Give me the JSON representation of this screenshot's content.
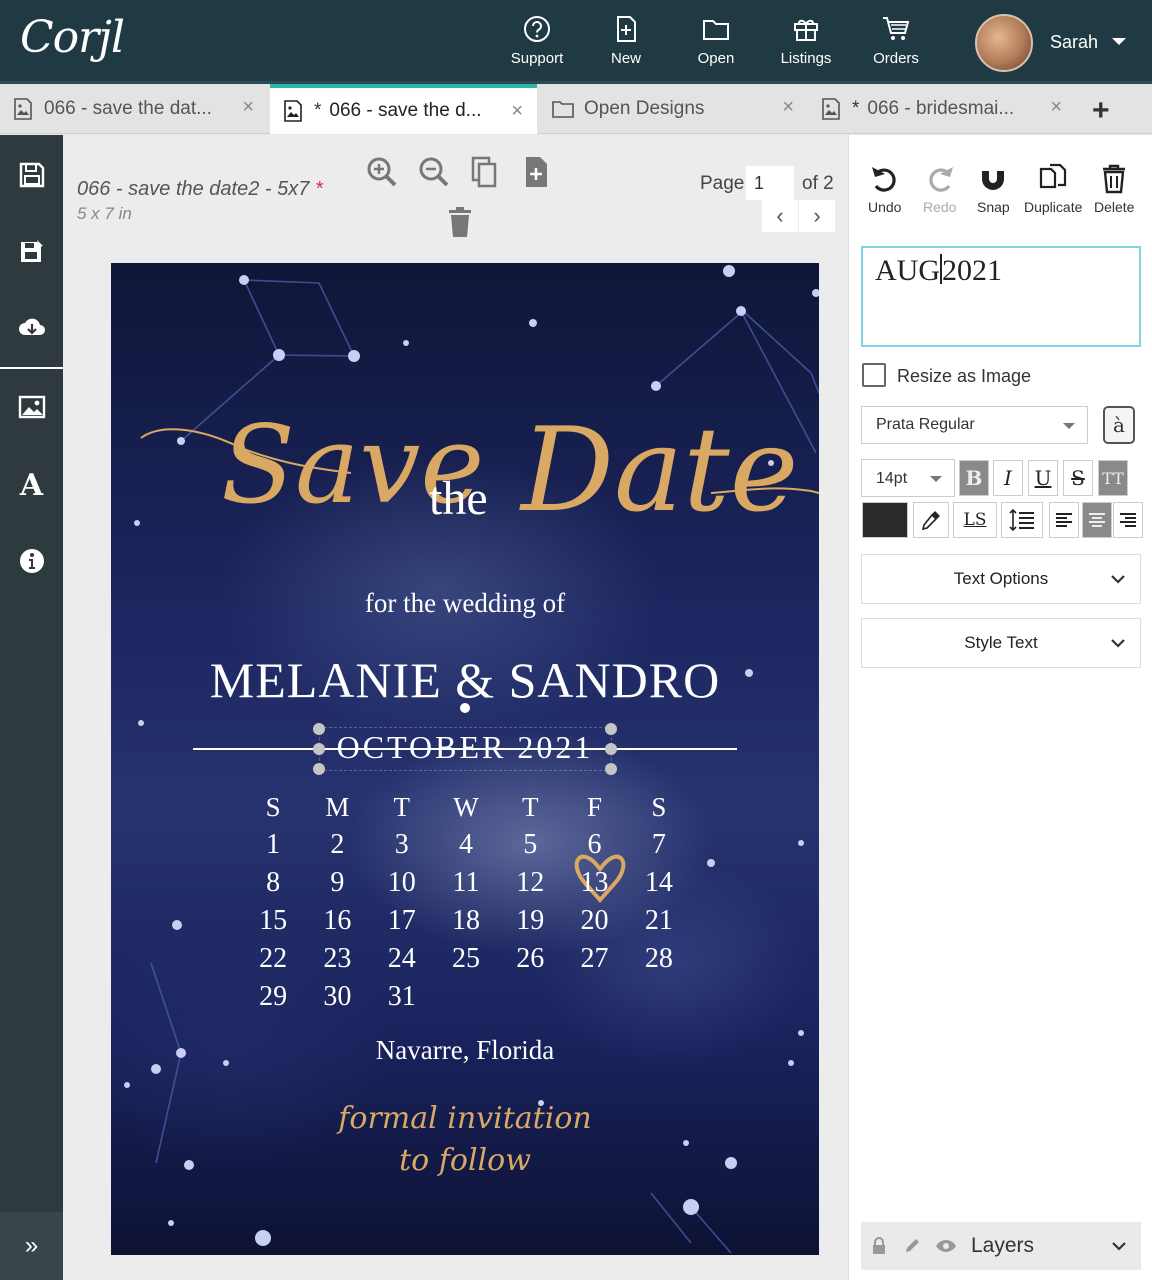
{
  "app": {
    "logo": "Corjl"
  },
  "topnav": [
    {
      "label": "Support",
      "icon": "help-icon"
    },
    {
      "label": "New",
      "icon": "new-file-icon"
    },
    {
      "label": "Open",
      "icon": "folder-icon"
    },
    {
      "label": "Listings",
      "icon": "gift-icon"
    },
    {
      "label": "Orders",
      "icon": "cart-icon"
    }
  ],
  "user": {
    "name": "Sarah"
  },
  "tabs": [
    {
      "label": "066 - save the dat...",
      "starred": false,
      "active": false,
      "icon": "image-file-icon"
    },
    {
      "label": "066 - save the d...",
      "starred": true,
      "active": true,
      "icon": "image-file-icon"
    },
    {
      "label": "Open Designs",
      "starred": false,
      "active": false,
      "icon": "folder-icon"
    },
    {
      "label": "066 - bridesmai...",
      "starred": true,
      "active": false,
      "icon": "image-file-icon"
    }
  ],
  "tab_close": "×",
  "tab_star": "*",
  "add_tab": "+",
  "sidebar": {
    "items": [
      "save-icon",
      "save-as-icon",
      "download-cloud-icon",
      "image-icon",
      "text-icon",
      "info-icon"
    ],
    "text_glyph": "A",
    "expand_glyph": "»"
  },
  "document": {
    "title": "066 - save the date2 - 5x7",
    "required_mark": "*",
    "size": "5 x 7 in",
    "page_label": "Page",
    "page_value": "1",
    "page_of": "of 2",
    "prev": "‹",
    "next": "›"
  },
  "design": {
    "script_save": "Save",
    "word_the": "the",
    "script_date": "Date",
    "subtitle": "for the wedding of",
    "names": "MELANIE & SANDRO",
    "month": "OCTOBER 2021",
    "weekdays": [
      "S",
      "M",
      "T",
      "W",
      "T",
      "F",
      "S"
    ],
    "weeks": [
      [
        "1",
        "2",
        "3",
        "4",
        "5",
        "6",
        "7"
      ],
      [
        "8",
        "9",
        "10",
        "11",
        "12",
        "13",
        "14"
      ],
      [
        "15",
        "16",
        "17",
        "18",
        "19",
        "20",
        "21"
      ],
      [
        "22",
        "23",
        "24",
        "25",
        "26",
        "27",
        "28"
      ],
      [
        "29",
        "30",
        "31",
        "",
        "",
        "",
        ""
      ]
    ],
    "highlight_date": "13",
    "location": "Navarre, Florida",
    "footer_line1": "formal invitation",
    "footer_line2": "to follow",
    "gold_color": "#d9a964"
  },
  "editor": {
    "undo": "Undo",
    "redo": "Redo",
    "snap": "Snap",
    "duplicate": "Duplicate",
    "delete": "Delete",
    "text_value_before_cursor": "AUG",
    "text_value_after_cursor": "2021",
    "resize_as_image": "Resize as Image",
    "font": "Prata Regular",
    "glyph_button": "à",
    "font_size": "14pt",
    "bold": "B",
    "italic": "I",
    "underline": "U",
    "strike": "S",
    "caps": "TT",
    "letter_spacing": "LS",
    "text_color": "#2a2a2a",
    "text_options": "Text Options",
    "style_text": "Style Text",
    "chevron": "⌄",
    "layers": "Layers"
  }
}
